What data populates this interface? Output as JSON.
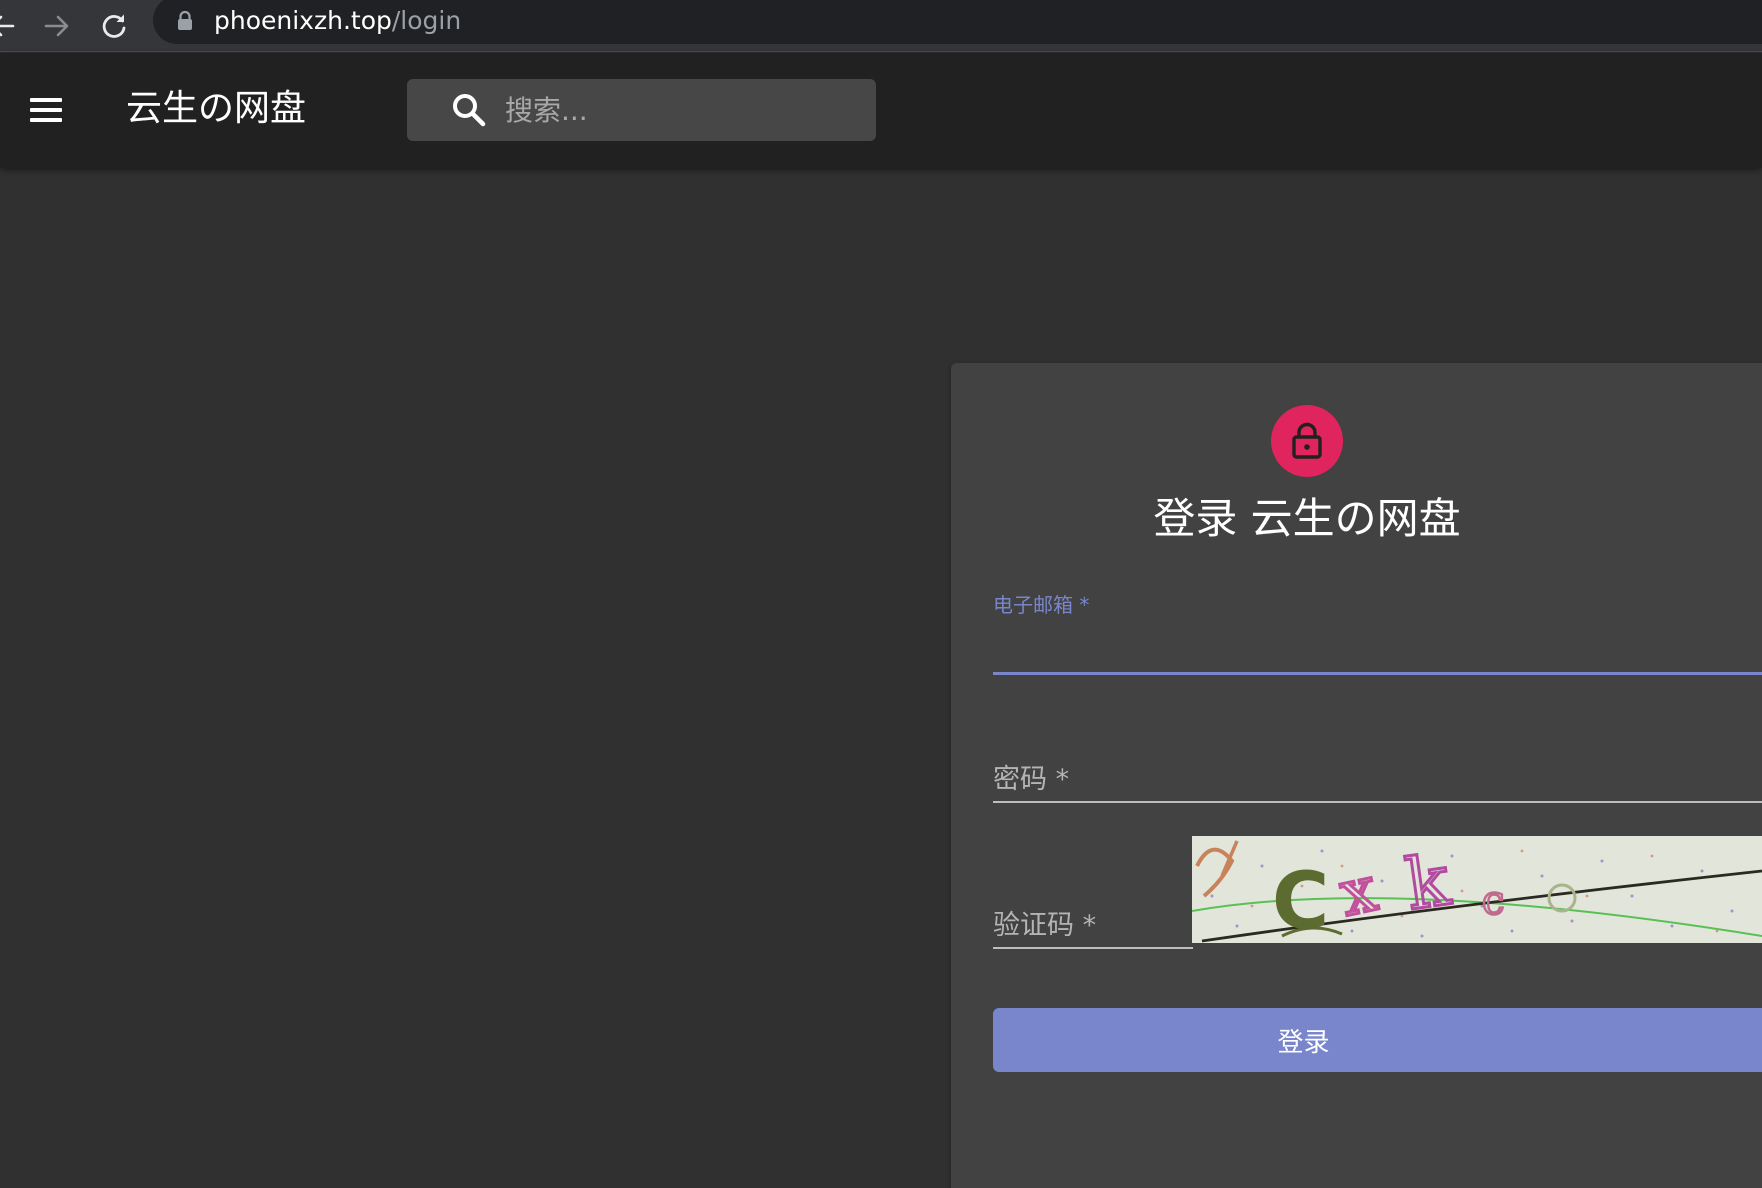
{
  "browser": {
    "url_domain": "phoenixzh.top",
    "url_path": "/login"
  },
  "appbar": {
    "title": "云生の网盘",
    "search_placeholder": "搜索..."
  },
  "login": {
    "title": "登录 云生の网盘",
    "email_label": "电子邮箱 *",
    "password_label": "密码 *",
    "captcha_label": "验证码 *",
    "captcha_text": "Cxk c",
    "submit_label": "登录"
  },
  "colors": {
    "accent": "#7986cb",
    "avatar": "#e0245e",
    "background": "#303030",
    "appbar": "#212121",
    "card": "#424242"
  },
  "icons": {
    "back": "back-arrow-icon",
    "forward": "forward-arrow-icon",
    "reload": "reload-icon",
    "secure": "lock-icon",
    "menu": "hamburger-menu-icon",
    "search": "search-icon",
    "avatar": "lock-outline-icon"
  }
}
